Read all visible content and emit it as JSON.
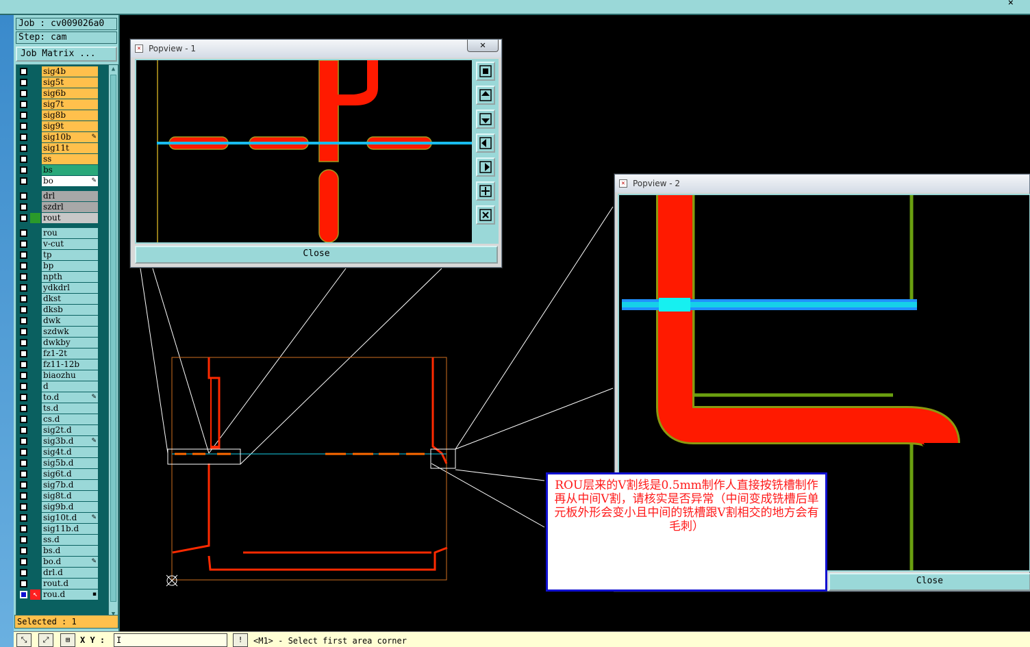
{
  "app": {
    "job_label": "Job : cv009026a0",
    "step_label": "Step: cam",
    "job_matrix_button": "Job Matrix ...",
    "selected_label": "Selected : 1"
  },
  "layers": [
    {
      "name": "sig4b",
      "color": "#ffc04c",
      "flag": ""
    },
    {
      "name": "sig5t",
      "color": "#ffc04c",
      "flag": ""
    },
    {
      "name": "sig6b",
      "color": "#ffc04c",
      "flag": ""
    },
    {
      "name": "sig7t",
      "color": "#ffc04c",
      "flag": ""
    },
    {
      "name": "sig8b",
      "color": "#ffc04c",
      "flag": ""
    },
    {
      "name": "sig9t",
      "color": "#ffc04c",
      "flag": ""
    },
    {
      "name": "sig10b",
      "color": "#ffc04c",
      "flag": "✎"
    },
    {
      "name": "sig11t",
      "color": "#ffc04c",
      "flag": ""
    },
    {
      "name": "ss",
      "color": "#ffc04c",
      "flag": ""
    },
    {
      "name": "bs",
      "color": "#2aa87a",
      "flag": ""
    },
    {
      "name": "bo",
      "color": "#ffffff",
      "flag": "✎"
    },
    {
      "name": "drl",
      "color": "#a8a8a8",
      "flag": ""
    },
    {
      "name": "szdrl",
      "color": "#a8a8a8",
      "flag": ""
    },
    {
      "name": "rout",
      "color": "#c8c8c8",
      "flag": "",
      "mark": "#2a9a2a"
    },
    {
      "name": "rou",
      "color": "#9ad8d8",
      "flag": ""
    },
    {
      "name": "v-cut",
      "color": "#9ad8d8",
      "flag": ""
    },
    {
      "name": "tp",
      "color": "#9ad8d8",
      "flag": ""
    },
    {
      "name": "bp",
      "color": "#9ad8d8",
      "flag": ""
    },
    {
      "name": "npth",
      "color": "#9ad8d8",
      "flag": ""
    },
    {
      "name": "ydkdrl",
      "color": "#9ad8d8",
      "flag": ""
    },
    {
      "name": "dkst",
      "color": "#9ad8d8",
      "flag": ""
    },
    {
      "name": "dksb",
      "color": "#9ad8d8",
      "flag": ""
    },
    {
      "name": "dwk",
      "color": "#9ad8d8",
      "flag": ""
    },
    {
      "name": "szdwk",
      "color": "#9ad8d8",
      "flag": ""
    },
    {
      "name": "dwkby",
      "color": "#9ad8d8",
      "flag": ""
    },
    {
      "name": "fz1-2t",
      "color": "#9ad8d8",
      "flag": ""
    },
    {
      "name": "fz11-12b",
      "color": "#9ad8d8",
      "flag": ""
    },
    {
      "name": "biaozhu",
      "color": "#9ad8d8",
      "flag": ""
    },
    {
      "name": "d",
      "color": "#9ad8d8",
      "flag": ""
    },
    {
      "name": "to.d",
      "color": "#9ad8d8",
      "flag": "✎"
    },
    {
      "name": "ts.d",
      "color": "#9ad8d8",
      "flag": ""
    },
    {
      "name": "cs.d",
      "color": "#9ad8d8",
      "flag": ""
    },
    {
      "name": "sig2t.d",
      "color": "#9ad8d8",
      "flag": ""
    },
    {
      "name": "sig3b.d",
      "color": "#9ad8d8",
      "flag": "✎"
    },
    {
      "name": "sig4t.d",
      "color": "#9ad8d8",
      "flag": ""
    },
    {
      "name": "sig5b.d",
      "color": "#9ad8d8",
      "flag": ""
    },
    {
      "name": "sig6t.d",
      "color": "#9ad8d8",
      "flag": ""
    },
    {
      "name": "sig7b.d",
      "color": "#9ad8d8",
      "flag": ""
    },
    {
      "name": "sig8t.d",
      "color": "#9ad8d8",
      "flag": ""
    },
    {
      "name": "sig9b.d",
      "color": "#9ad8d8",
      "flag": ""
    },
    {
      "name": "sig10t.d",
      "color": "#9ad8d8",
      "flag": "✎"
    },
    {
      "name": "sig11b.d",
      "color": "#9ad8d8",
      "flag": ""
    },
    {
      "name": "ss.d",
      "color": "#9ad8d8",
      "flag": ""
    },
    {
      "name": "bs.d",
      "color": "#9ad8d8",
      "flag": ""
    },
    {
      "name": "bo.d",
      "color": "#9ad8d8",
      "flag": "✎"
    },
    {
      "name": "drl.d",
      "color": "#9ad8d8",
      "flag": ""
    },
    {
      "name": "rout.d",
      "color": "#9ad8d8",
      "flag": ""
    },
    {
      "name": "rou.d",
      "color": "#9ad8d8",
      "flag": "▪",
      "active": true
    }
  ],
  "popview1": {
    "title": "Popview - 1",
    "close_label": "Close",
    "x_label": "✕"
  },
  "popview2": {
    "title": "Popview - 2",
    "close_label": "Close"
  },
  "annotation": {
    "text": "ROU层来的V割线是0.5mm制作人直接按铣槽制作再从中间V割，请核实是否异常（中间变成铣槽后单元板外形会变小且中间的铣槽跟V割相交的地方会有毛刺）"
  },
  "status": {
    "xy_label": "X Y :",
    "xy_value": "I",
    "message": "<M1> - Select first area corner"
  },
  "colors": {
    "panel": "#9ad8d8",
    "signal_layer": "#ffc04c",
    "route_red": "#ff1a00",
    "vcut_cyan": "#16d0e8",
    "outline_green": "#6aa010"
  }
}
